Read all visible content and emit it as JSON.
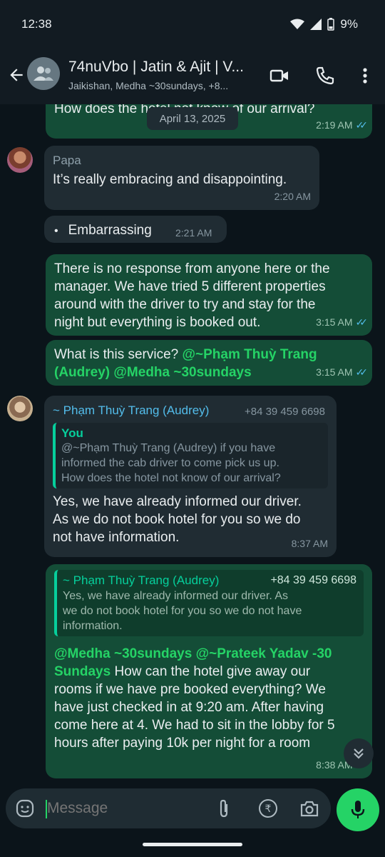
{
  "status_bar": {
    "time": "12:38",
    "battery": "9%"
  },
  "header": {
    "title": "74nuVbo | Jatin & Ajit | V...",
    "subtitle": "Jaikishan, Medha ~30sundays, +8..."
  },
  "date_pill": "April 13, 2025",
  "messages": {
    "m1": {
      "text": "How does the hotel not know of our arrival?",
      "time": "2:19 AM"
    },
    "m2": {
      "sender": "Papa",
      "text": "It’s really embracing and disappointing.",
      "time": "2:20 AM"
    },
    "m3": {
      "bullet": "•",
      "text": "Embarrassing",
      "time": "2:21 AM"
    },
    "m4": {
      "lines": [
        "There is no response from anyone here or the",
        "manager. We have tried 5 different properties",
        "around with the driver to try and stay for the",
        "night but everything is booked out."
      ],
      "time": "3:15 AM"
    },
    "m5": {
      "text": "What is this service?",
      "mention1": "@~Phạm Thuỳ Trang",
      "mention2": "(Audrey) @Medha ~30sundays",
      "time": "3:15 AM"
    },
    "m6": {
      "sender": "~ Phạm Thuỳ Trang (Audrey)",
      "phone": "+84 39 459 6698",
      "quote_author": "You",
      "quote_lines": [
        "@~Phạm Thuỳ Trang (Audrey) if you have",
        "informed the cab driver to come pick us up.",
        "How does the hotel not know of our arrival?"
      ],
      "lines": [
        "Yes, we have already informed our driver.",
        "As we do not book hotel for you so we do",
        "not have information."
      ],
      "time": "8:37 AM"
    },
    "m7": {
      "quote_author": "~ Phạm Thuỳ Trang (Audrey)",
      "quote_phone": "+84 39 459 6698",
      "quote_lines": [
        "Yes, we have already informed our driver. As",
        "we do not book hotel for you so we do not have",
        "information."
      ],
      "mention_line1": "@Medha ~30sundays @~Prateek Yadav -30",
      "mention_line2": "Sundays",
      "line2_rest": " How can the hotel give away our",
      "lines": [
        "rooms if we have pre booked everything? We",
        "have just checked in at 9:20 am. After having",
        "come here at 4. We had to sit in the lobby for 5",
        "hours after paying 10k per night for a room"
      ],
      "time": "8:38 AM"
    }
  },
  "input": {
    "placeholder": "Message"
  },
  "colors": {
    "outgoing": "#144d37",
    "incoming": "#202c33",
    "accent": "#25d366",
    "read_tick": "#53bdeb"
  }
}
